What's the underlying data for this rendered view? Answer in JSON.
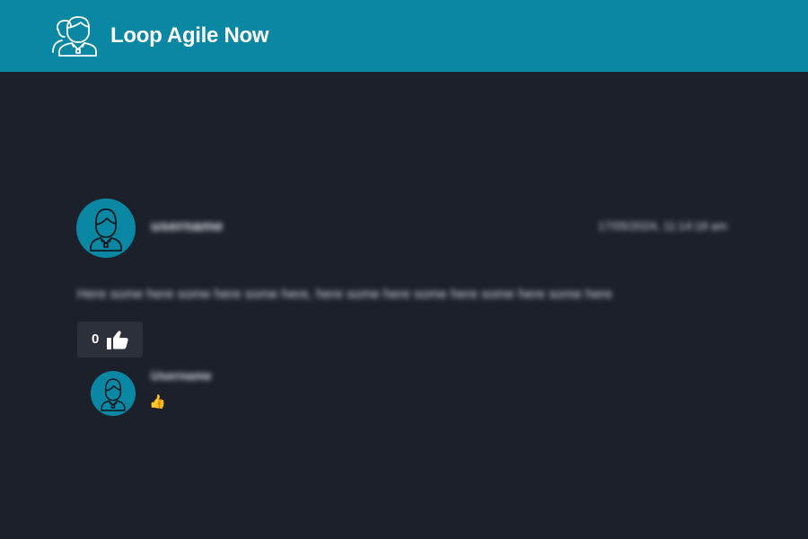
{
  "header": {
    "title": "Loop Agile Now",
    "logo_icon": "users-icon",
    "background": "#0a88a3"
  },
  "post": {
    "author": "username",
    "timestamp": "17/05/2024, 11:14:18 am",
    "body": "Here some here some here some here, here some here some here some here some here",
    "like_count": "0",
    "like_icon": "thumbs-up-icon"
  },
  "reply": {
    "author": "Username",
    "text": "👍"
  },
  "colors": {
    "accent": "#0a88a3",
    "background": "#1c202b",
    "button": "#2c303a"
  }
}
